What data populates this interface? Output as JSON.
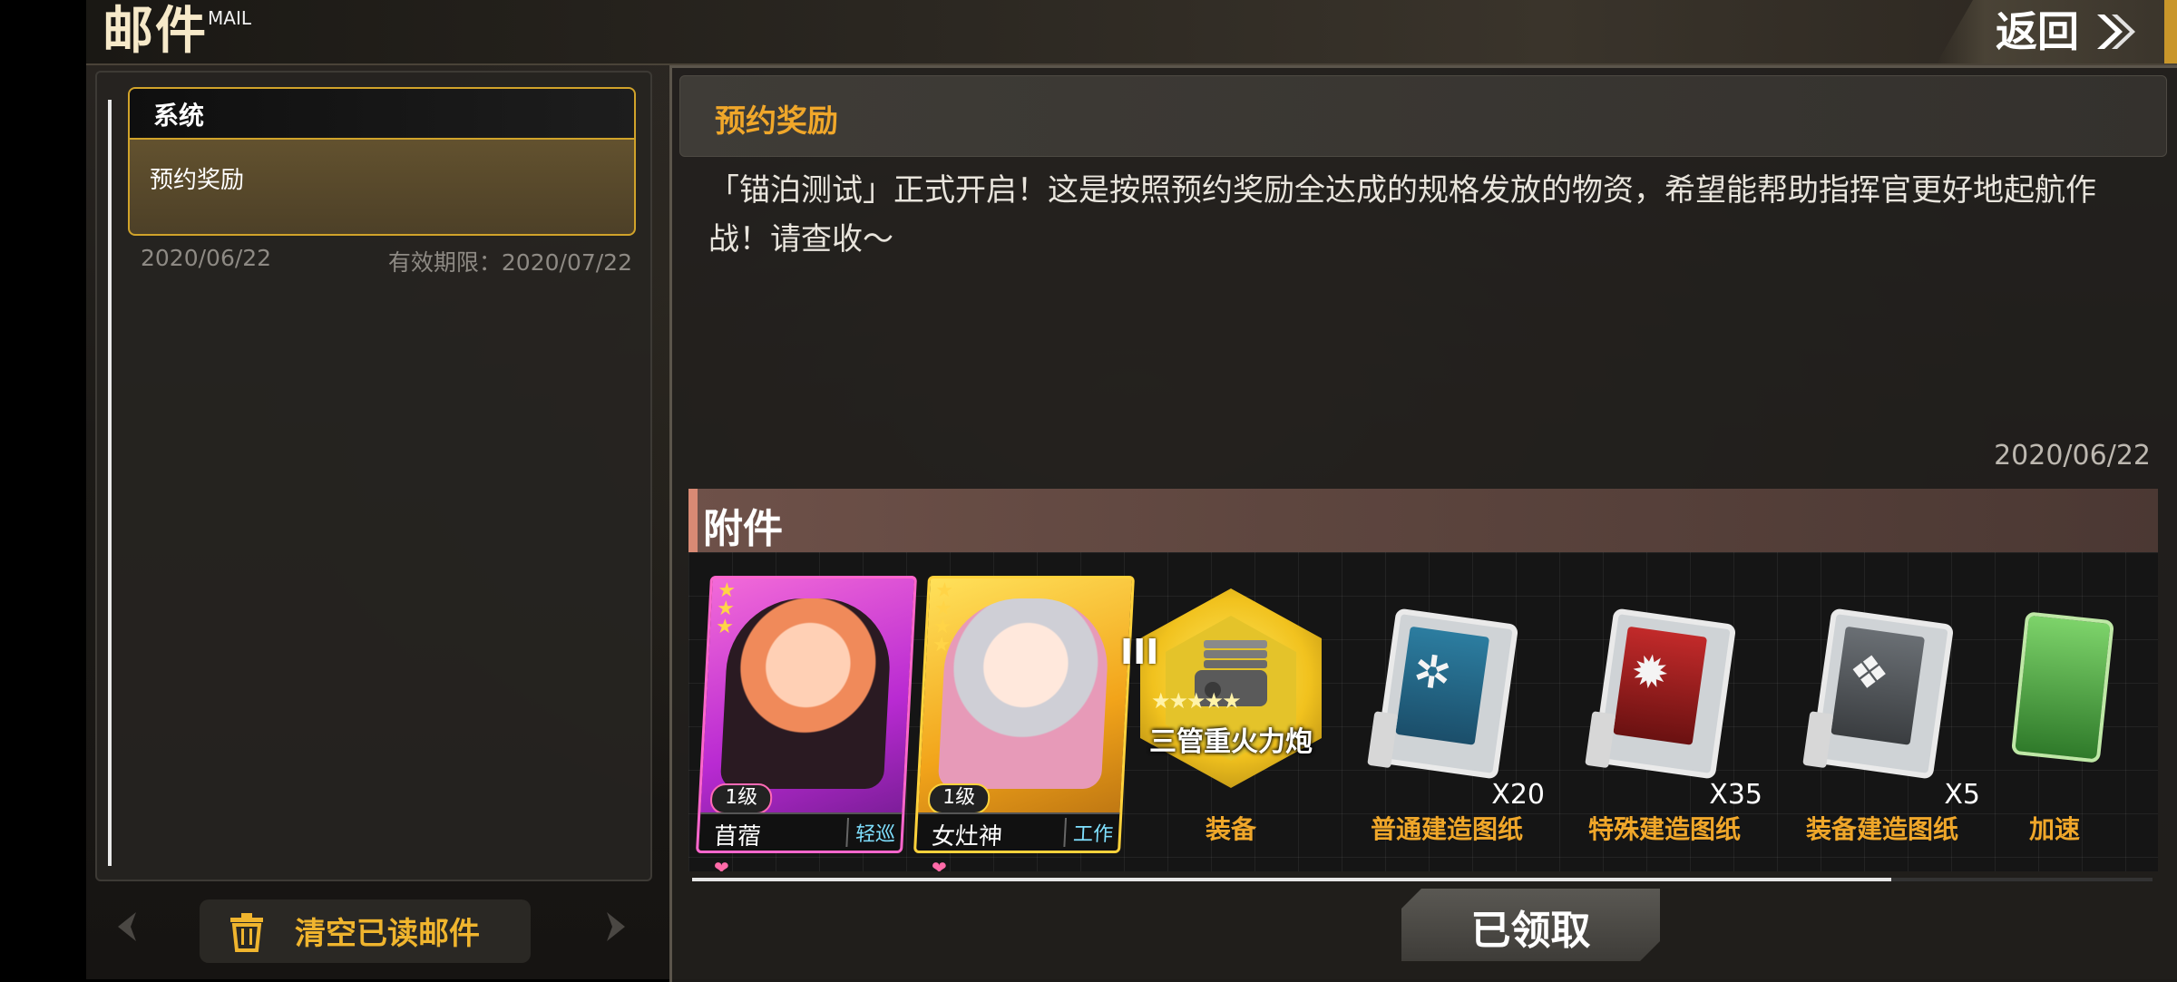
{
  "header": {
    "title": "邮件",
    "title_en": "MAIL",
    "back_label": "返回"
  },
  "mail_list": {
    "items": [
      {
        "sender": "系统",
        "subject": "预约奖励",
        "date": "2020/06/22",
        "expire": "有效期限：2020/07/22"
      }
    ],
    "clear_button": "清空已读邮件"
  },
  "detail": {
    "subject": "预约奖励",
    "body": "「锚泊测试」正式开启！这是按照预约奖励全达成的规格发放的物资，希望能帮助指挥官更好地起航作战！请查收～",
    "date": "2020/06/22",
    "attachments_title": "附件",
    "attachments": [
      {
        "kind": "character",
        "name": "苜蓿",
        "level": "1级",
        "type": "轻巡",
        "rarity_color": "#ff66cc"
      },
      {
        "kind": "character",
        "name": "女灶神",
        "level": "1级",
        "type": "工作",
        "rarity_color": "#ffd23b"
      },
      {
        "kind": "equipment",
        "name": "三管重火力炮",
        "tier": "III",
        "label": "装备"
      },
      {
        "kind": "item",
        "label": "普通建造图纸",
        "qty": "X20",
        "icon": "blueprint-blue-icon"
      },
      {
        "kind": "item",
        "label": "特殊建造图纸",
        "qty": "X35",
        "icon": "blueprint-red-icon"
      },
      {
        "kind": "item",
        "label": "装备建造图纸",
        "qty": "X5",
        "icon": "blueprint-gray-icon"
      },
      {
        "kind": "item",
        "label": "加速",
        "icon": "speedup-icon"
      }
    ],
    "claim_button": "已领取"
  },
  "colors": {
    "accent_gold": "#d1a32a",
    "accent_orange": "#f0a72a"
  }
}
